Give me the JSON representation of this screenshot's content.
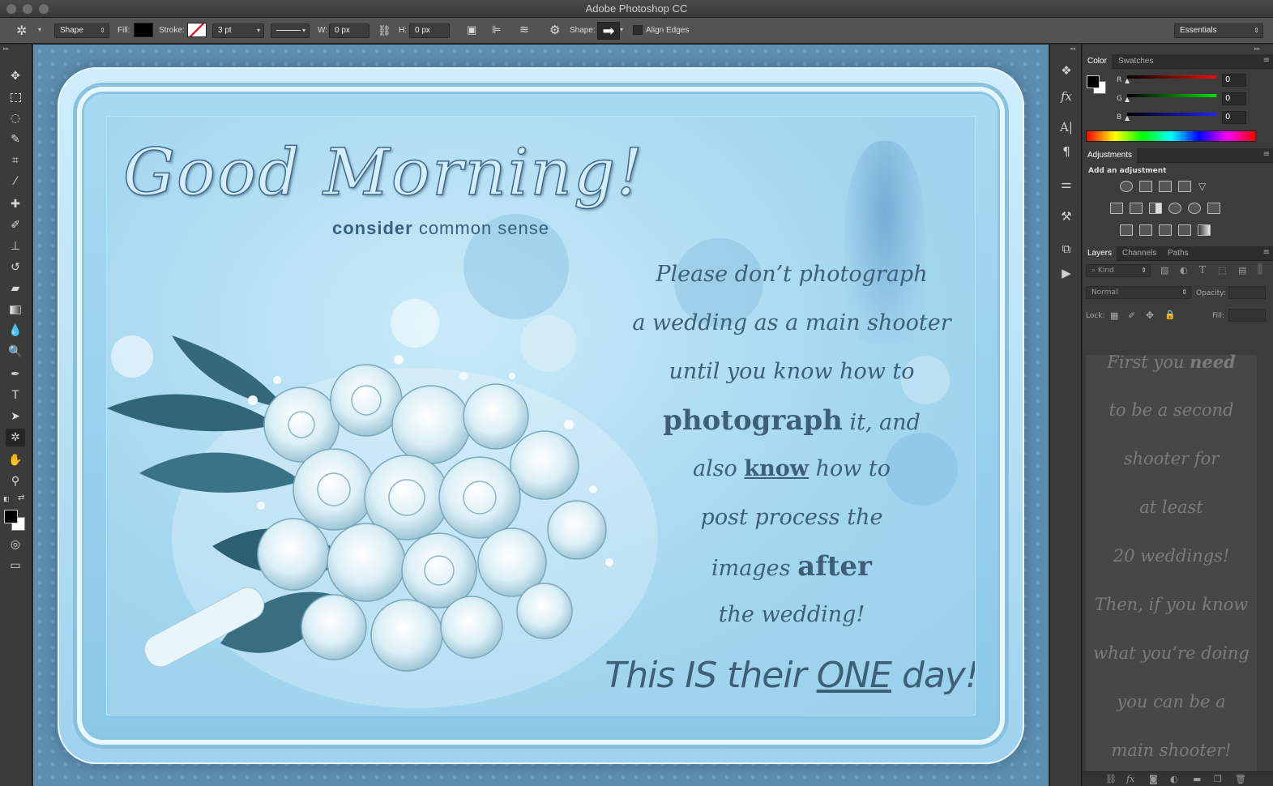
{
  "app": {
    "title": "Adobe Photoshop CC"
  },
  "options": {
    "tool_mode": "Shape",
    "fill_label": "Fill:",
    "stroke_label": "Stroke:",
    "stroke_width": "3 pt",
    "w_label": "W:",
    "w_value": "0 px",
    "h_label": "H:",
    "h_value": "0 px",
    "shape_label": "Shape:",
    "align_edges": "Align Edges",
    "workspace": "Essentials"
  },
  "canvas": {
    "headline": "Good Morning!",
    "sub_bold": "consider",
    "sub_rest": " common sense",
    "lines": [
      "Please don’t photograph",
      "a wedding as a main shooter",
      "until you know how to"
    ],
    "l4_bold": "photograph",
    "l4_rest": " it, and",
    "l5_a": "also ",
    "l5_u": "know",
    "l5_b": " how to",
    "l6": "post process the",
    "l7_a": "images ",
    "l7_bold": "after",
    "l8": "the wedding!",
    "l9_a": "This IS their ",
    "l9_u": "ONE",
    "l9_b": " day!"
  },
  "panels": {
    "color_tabs": [
      "Color",
      "Swatches"
    ],
    "channels": [
      {
        "label": "R",
        "value": "0"
      },
      {
        "label": "G",
        "value": "0"
      },
      {
        "label": "B",
        "value": "0"
      }
    ],
    "adjustments_tab": "Adjustments",
    "add_adjustment": "Add an adjustment",
    "layers_tabs": [
      "Layers",
      "Channels",
      "Paths"
    ],
    "kind": "Kind",
    "blend": "Normal",
    "opacity_label": "Opacity:",
    "lock_label": "Lock:",
    "fill_label": "Fill:"
  },
  "layer_text": {
    "l1_a": "First you ",
    "l1_b": "need",
    "rest": [
      "to be a second",
      "shooter for",
      "at least",
      "20 weddings!",
      "Then, if you know",
      "what you’re doing",
      "you can be a",
      "main shooter!"
    ]
  },
  "colors": {
    "accent_blue": "#3d5f78",
    "canvas_blue": "#5d8eb0",
    "ui_dark": "#3b3b3b"
  }
}
